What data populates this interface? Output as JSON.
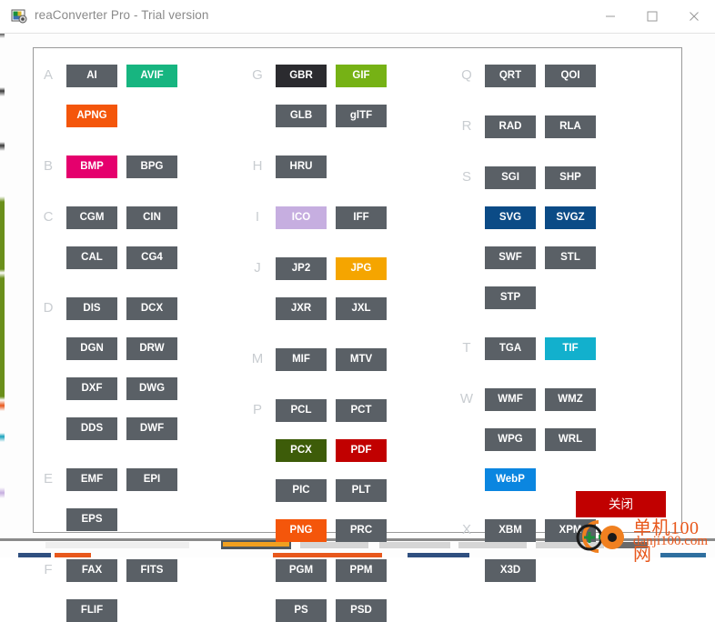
{
  "window": {
    "title": "reaConverter Pro - Trial version",
    "icon": "app-icon",
    "controls": [
      {
        "name": "minimize",
        "glyph": "minimize-icon"
      },
      {
        "name": "maximize",
        "glyph": "maximize-icon"
      },
      {
        "name": "close",
        "glyph": "close-icon"
      }
    ]
  },
  "dialog": {
    "close_button_label": "关闭",
    "columns": [
      {
        "id": "col1",
        "groups": [
          {
            "letter": "A",
            "rows": [
              [
                "AI",
                "AVIF"
              ],
              [
                "APNG"
              ]
            ]
          },
          {
            "letter": "B",
            "rows": [
              [
                "BMP",
                "BPG"
              ]
            ]
          },
          {
            "letter": "C",
            "rows": [
              [
                "CGM",
                "CIN"
              ],
              [
                "CAL",
                "CG4"
              ]
            ]
          },
          {
            "letter": "D",
            "rows": [
              [
                "DIS",
                "DCX"
              ],
              [
                "DGN",
                "DRW"
              ],
              [
                "DXF",
                "DWG"
              ],
              [
                "DDS",
                "DWF"
              ]
            ]
          },
          {
            "letter": "E",
            "rows": [
              [
                "EMF",
                "EPI"
              ],
              [
                "EPS"
              ]
            ]
          },
          {
            "letter": "F",
            "rows": [
              [
                "FAX",
                "FITS"
              ],
              [
                "FLIF"
              ]
            ]
          }
        ]
      },
      {
        "id": "col2",
        "groups": [
          {
            "letter": "G",
            "rows": [
              [
                "GBR",
                "GIF"
              ],
              [
                "GLB",
                "glTF"
              ]
            ]
          },
          {
            "letter": "H",
            "rows": [
              [
                "HRU"
              ]
            ]
          },
          {
            "letter": "I",
            "rows": [
              [
                "ICO",
                "IFF"
              ]
            ]
          },
          {
            "letter": "J",
            "rows": [
              [
                "JP2",
                "JPG"
              ],
              [
                "JXR",
                "JXL"
              ]
            ]
          },
          {
            "letter": "M",
            "rows": [
              [
                "MIF",
                "MTV"
              ]
            ]
          },
          {
            "letter": "P",
            "rows": [
              [
                "PCL",
                "PCT"
              ],
              [
                "PCX",
                "PDF"
              ],
              [
                "PIC",
                "PLT"
              ],
              [
                "PNG",
                "PRC"
              ],
              [
                "PGM",
                "PPM"
              ],
              [
                "PS",
                "PSD"
              ]
            ]
          }
        ]
      },
      {
        "id": "col3",
        "groups": [
          {
            "letter": "Q",
            "rows": [
              [
                "QRT",
                "QOI"
              ]
            ]
          },
          {
            "letter": "R",
            "rows": [
              [
                "RAD",
                "RLA"
              ]
            ]
          },
          {
            "letter": "S",
            "rows": [
              [
                "SGI",
                "SHP"
              ],
              [
                "SVG",
                "SVGZ"
              ],
              [
                "SWF",
                "STL"
              ],
              [
                "STP"
              ]
            ]
          },
          {
            "letter": "T",
            "rows": [
              [
                "TGA",
                "TIF"
              ]
            ]
          },
          {
            "letter": "W",
            "rows": [
              [
                "WMF",
                "WMZ"
              ],
              [
                "WPG",
                "WRL"
              ],
              [
                "WebP"
              ]
            ]
          },
          {
            "letter": "X",
            "rows": [
              [
                "XBM",
                "XPM"
              ],
              [
                "X3D"
              ]
            ]
          }
        ]
      }
    ],
    "format_colors": {
      "default": "#5a6066",
      "AVIF": "#17b580",
      "APNG": "#f4560b",
      "BMP": "#e5006d",
      "GBR": "#2b2b2f",
      "GIF": "#76b215",
      "ICO": "#c6aee0",
      "JPG": "#f5a500",
      "PCX": "#3d5c09",
      "PDF": "#c10000",
      "PNG": "#f4560b",
      "SVG": "#0b4b86",
      "SVGZ": "#0b4b86",
      "TIF": "#12b0cd",
      "WebP": "#0b86e0"
    },
    "format_text_colors": {
      "ICO": "#ffffff"
    }
  },
  "watermark": {
    "line1": "单机100网",
    "line2": "danji100.com",
    "color": "#e8581c"
  },
  "background_app": {
    "tab_highlight_color": "#f0a020"
  }
}
